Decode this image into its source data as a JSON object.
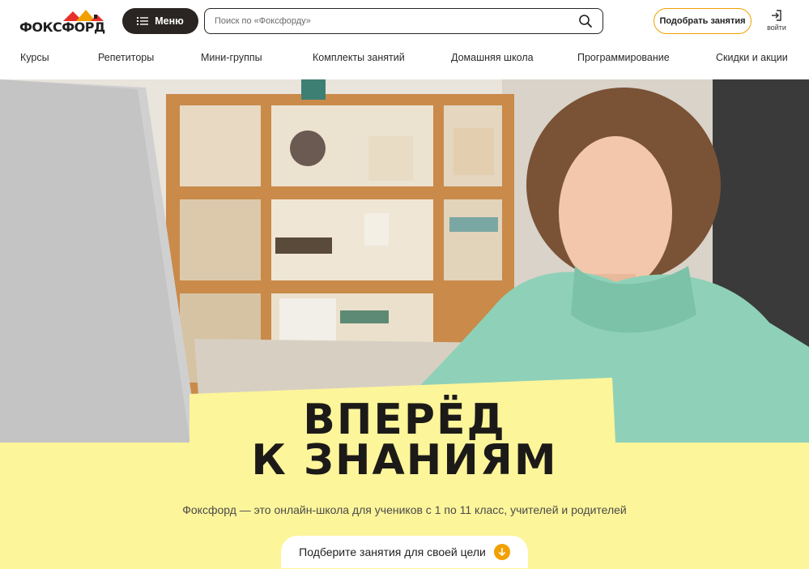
{
  "header": {
    "logo_text": "ФОКСФОРД",
    "menu_label": "Меню",
    "search_placeholder": "Поиск по «Фоксфорду»",
    "search_value": "",
    "pick_label": "Подобрать занятия",
    "login_label": "войти"
  },
  "nav": {
    "items": [
      {
        "label": "Курсы"
      },
      {
        "label": "Репетиторы"
      },
      {
        "label": "Мини-группы"
      },
      {
        "label": "Комплекты занятий"
      },
      {
        "label": "Домашняя школа"
      },
      {
        "label": "Программирование"
      },
      {
        "label": "Скидки и акции"
      }
    ]
  },
  "hero": {
    "headline_line1": "ВПЕРЁД",
    "headline_line2": "К ЗНАНИЯМ",
    "subtitle": "Фоксфорд — это онлайн-школа для учеников с 1 по 11 класс, учителей и родителей",
    "cta_label": "Подберите занятия для своей цели"
  },
  "colors": {
    "accent": "#f2a000",
    "dark": "#2a2522",
    "yellow": "#fdf59a",
    "hoodie": "#8fd1b8"
  },
  "icons": {
    "menu": "list-icon",
    "search": "search-icon",
    "login": "login-icon",
    "cta": "arrow-down-icon"
  }
}
